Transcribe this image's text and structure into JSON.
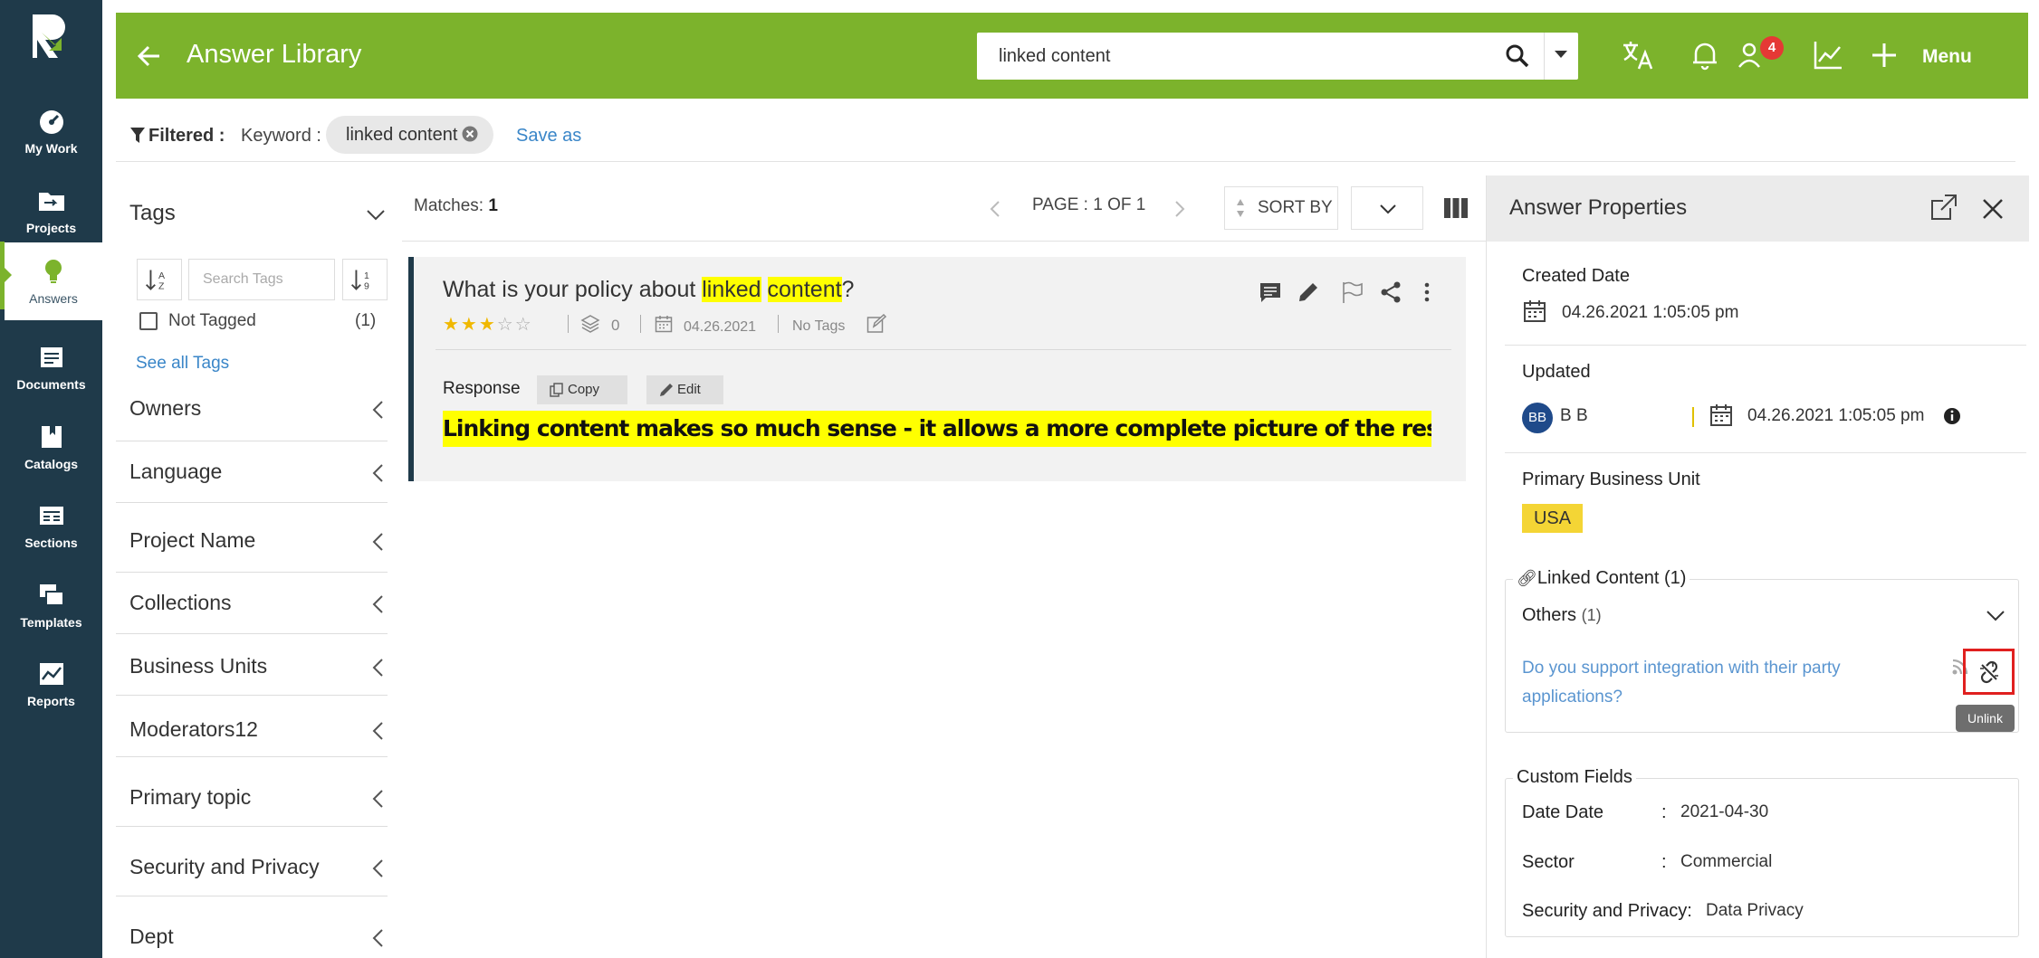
{
  "nav": {
    "items": [
      {
        "label": "My Work",
        "icon": "gauge-icon"
      },
      {
        "label": "Projects",
        "icon": "folder-icon"
      },
      {
        "label": "Answers",
        "icon": "lightbulb-icon"
      },
      {
        "label": "Documents",
        "icon": "document-icon"
      },
      {
        "label": "Catalogs",
        "icon": "book-icon"
      },
      {
        "label": "Sections",
        "icon": "sections-icon"
      },
      {
        "label": "Templates",
        "icon": "templates-icon"
      },
      {
        "label": "Reports",
        "icon": "reports-icon"
      }
    ],
    "active": "Answers"
  },
  "header": {
    "title": "Answer Library",
    "search_value": "linked content",
    "notification_count": "4",
    "menu_label": "Menu"
  },
  "filterbar": {
    "filtered_label": "Filtered :",
    "keyword_label": "Keyword :",
    "chip_value": "linked content",
    "save_as": "Save as"
  },
  "filters": {
    "tags_title": "Tags",
    "tag_search_placeholder": "Search Tags",
    "not_tagged_label": "Not Tagged",
    "not_tagged_count": "(1)",
    "see_all": "See all Tags",
    "facets": [
      "Owners",
      "Language",
      "Project Name",
      "Collections",
      "Business Units",
      "Moderators12",
      "Primary topic",
      "Security and Privacy",
      "Dept"
    ]
  },
  "results": {
    "matches_label": "Matches:",
    "matches_count": "1",
    "page_text": "PAGE : 1 OF 1",
    "sort_by": "SORT BY",
    "card": {
      "question_pre": "What is your policy about ",
      "question_hl1": "linked",
      "question_space": " ",
      "question_hl2": "content",
      "question_post": "?",
      "rating": 3,
      "rating_max": 5,
      "versions": "0",
      "date": "04.26.2021",
      "tags": "No Tags",
      "response_label": "Response",
      "copy_label": "Copy",
      "edit_label": "Edit",
      "response_text": "Linking content makes so much sense - it allows a more complete picture of the response."
    }
  },
  "properties": {
    "title": "Answer Properties",
    "created_label": "Created Date",
    "created_value": "04.26.2021 1:05:05 pm",
    "updated_label": "Updated",
    "updated_user_initials": "BB",
    "updated_user": "B B",
    "updated_value": "04.26.2021 1:05:05 pm",
    "bu_label": "Primary Business Unit",
    "bu_value": "USA",
    "linked_title": "Linked Content (1)",
    "others_label": "Others",
    "others_count": "(1)",
    "linked_question_line1": "Do you support integration with their party",
    "linked_question_line2": "applications?",
    "unlink_tooltip": "Unlink",
    "custom_title": "Custom Fields",
    "custom_fields": [
      {
        "label": "Date Date",
        "sep": ":",
        "value": "2021-04-30"
      },
      {
        "label": "Sector",
        "sep": ":",
        "value": "Commercial"
      },
      {
        "label": "Security and Privacy:",
        "sep": "",
        "value": "Data Privacy"
      }
    ]
  },
  "colors": {
    "header_green": "#7cb32c",
    "nav_dark": "#1f3a4a",
    "highlight": "#ffff00",
    "link_blue": "#3a86c8",
    "badge_red": "#e53935",
    "bu_yellow": "#f4d535"
  }
}
